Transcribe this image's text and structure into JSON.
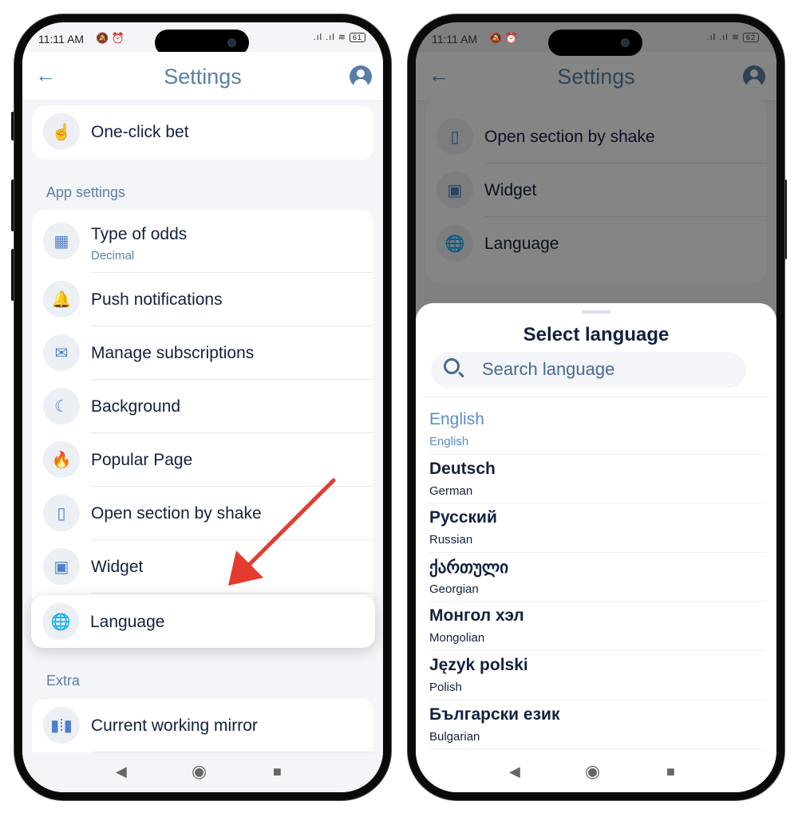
{
  "status_left": {
    "time": "11:11 AM",
    "icons": "🔕 ⏰",
    "battery": "61"
  },
  "status_right": {
    "time": "11:11 AM",
    "icons": "🔕 ⏰",
    "battery": "62"
  },
  "header": {
    "title": "Settings",
    "back_icon": "arrow-left-icon",
    "profile_icon": "user-circle-icon"
  },
  "left": {
    "top_item": {
      "label": "One-click bet",
      "icon": "tap-icon"
    },
    "app_settings_label": "App settings",
    "app_items": [
      {
        "label": "Type of odds",
        "sub": "Decimal",
        "icon": "grid-icon"
      },
      {
        "label": "Push notifications",
        "icon": "bell-icon"
      },
      {
        "label": "Manage subscriptions",
        "icon": "mail-icon"
      },
      {
        "label": "Background",
        "icon": "moon-icon"
      },
      {
        "label": "Popular Page",
        "icon": "flame-icon"
      },
      {
        "label": "Open section by shake",
        "icon": "phone-shake-icon"
      },
      {
        "label": "Widget",
        "icon": "widget-icon"
      },
      {
        "label": "Language",
        "icon": "globe-icon"
      }
    ],
    "extra_label": "Extra",
    "extra_items": [
      {
        "label": "Current working mirror",
        "icon": "mirror-icon"
      }
    ]
  },
  "right": {
    "bg_items": [
      {
        "label": "Open section by shake"
      },
      {
        "label": "Widget"
      },
      {
        "label": "Language"
      }
    ],
    "sheet": {
      "title": "Select language",
      "search_placeholder": "Search language",
      "languages": [
        {
          "name": "English",
          "english": "English",
          "selected": true
        },
        {
          "name": "Deutsch",
          "english": "German"
        },
        {
          "name": "Русский",
          "english": "Russian"
        },
        {
          "name": "ქართული",
          "english": "Georgian"
        },
        {
          "name": "Монгол хэл",
          "english": "Mongolian"
        },
        {
          "name": "Język polski",
          "english": "Polish"
        },
        {
          "name": "Български език",
          "english": "Bulgarian"
        }
      ]
    }
  },
  "colors": {
    "accent": "#5a7fa6",
    "selected": "#5b8ccc",
    "text": "#13213f",
    "arrow": "#e53b2f"
  }
}
